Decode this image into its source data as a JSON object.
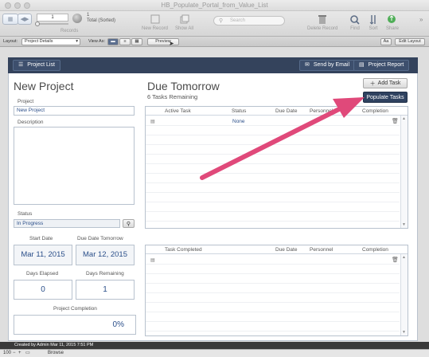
{
  "window": {
    "title": "HB_Populate_Portal_from_Value_List"
  },
  "toolbar": {
    "record_number": "1",
    "total_label": "Total (Sorted)",
    "total_count": "1",
    "records_label": "Records",
    "new_record": "New Record",
    "show_all": "Show All",
    "search_placeholder": "Search",
    "delete_record": "Delete Record",
    "find": "Find",
    "sort": "Sort",
    "share": "Share"
  },
  "layoutbar": {
    "layout_label": "Layout:",
    "layout_value": "Project Details",
    "view_as_label": "View As:",
    "preview": "Preview",
    "aa": "Aa",
    "edit_layout": "Edit Layout"
  },
  "header": {
    "project_list": "Project List",
    "send_by_email": "Send by Email",
    "project_report": "Project Report"
  },
  "left": {
    "title": "New Project",
    "project_label": "Project",
    "project_value": "New Project",
    "description_label": "Description",
    "status_label": "Status",
    "status_value": "In Progress",
    "start_date_label": "Start Date",
    "start_date_value": "Mar 11, 2015",
    "due_date_label": "Due Date Tomorrow",
    "due_date_value": "Mar 12, 2015",
    "days_elapsed_label": "Days Elapsed",
    "days_elapsed_value": "0",
    "days_remaining_label": "Days Remaining",
    "days_remaining_value": "1",
    "completion_label": "Project Completion",
    "completion_value": "0%"
  },
  "right": {
    "title": "Due Tomorrow",
    "subtitle": "6 Tasks Remaining",
    "add_task": "Add Task",
    "populate_tasks": "Populate Tasks",
    "active_headers": [
      "Active Task",
      "Status",
      "Due Date",
      "Personnel",
      "Completion"
    ],
    "active_first_status": "None",
    "completed_headers": [
      "Task Completed",
      "Due Date",
      "Personnel",
      "Completion"
    ]
  },
  "statusbar": {
    "created": "Created by Admin Mar 11, 2015 7:51 PM"
  },
  "bottombar": {
    "zoom": "100",
    "mode": "Browse"
  },
  "colors": {
    "header": "#34435c",
    "accent_text": "#2b4f8a",
    "arrow": "#e0497a"
  }
}
